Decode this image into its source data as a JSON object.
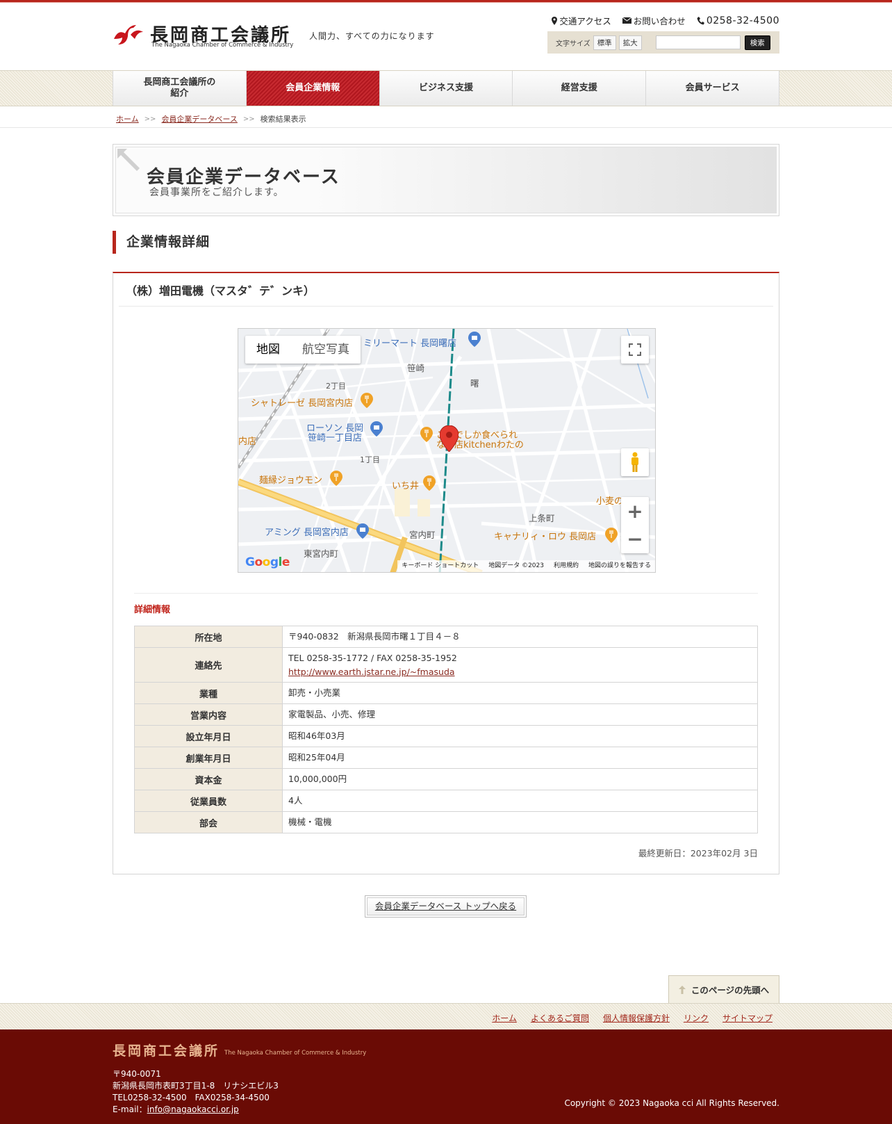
{
  "header": {
    "logo_name": "長岡商工会議所",
    "logo_en": "The Nagaoka Chamber of Commerce & Industry",
    "tagline": "人間力、すべての力になります",
    "links": {
      "access": "交通アクセス",
      "contact": "お問い合わせ",
      "tel": "0258-32-4500"
    },
    "font_size_label": "文字サイズ",
    "font_standard": "標準",
    "font_large": "拡大",
    "search_button": "検索",
    "search_value": ""
  },
  "nav": {
    "items": [
      {
        "label": "長岡商工会議所の\n紹介"
      },
      {
        "label": "会員企業情報",
        "active": true
      },
      {
        "label": "ビジネス支援"
      },
      {
        "label": "経営支援"
      },
      {
        "label": "会員サービス"
      }
    ]
  },
  "breadcrumb": {
    "home": "ホーム",
    "db": "会員企業データベース",
    "current": "検索結果表示"
  },
  "banner": {
    "title": "会員企業データベース",
    "subtitle": "会員事業所をご紹介します。"
  },
  "section_title": "企業情報詳細",
  "company": {
    "name": "（株）増田電機（マスタ゛テ゛ンキ）"
  },
  "map": {
    "type_map": "地図",
    "type_satellite": "航空写真",
    "labels": {
      "familymart": "ミリーマート 長岡曙店",
      "sasazaki": "笹崎",
      "akebono": "曙",
      "chome2": "2丁目",
      "chateraise": "シャトレーゼ 長岡宮内店",
      "lawson1": "ローソン 長岡",
      "lawson2": "笹崎一丁目店",
      "store_left": "内店",
      "kitchen1": "ここでしか食べられ",
      "kitchen2": "ない店kitchenわたの",
      "chome1": "1丁目",
      "jouwon": "麺縁ジョウモン",
      "ichii": "いち井",
      "komugi": "小麦の",
      "kamijo": "上条町",
      "aming": "アミング 長岡宮内店",
      "miyauchi": "宮内町",
      "kyanari": "キャナリィ・ロウ 長岡店",
      "higashi": "東宮内町"
    },
    "google": "Google",
    "attribution": [
      "キーボード ショートカット",
      "地図データ ©2023",
      "利用規約",
      "地図の誤りを報告する"
    ]
  },
  "details": {
    "title": "詳細情報",
    "rows": [
      {
        "label": "所在地",
        "value": "〒940-0832　新潟県長岡市曙１丁目４－８"
      },
      {
        "label": "連絡先",
        "value": "TEL 0258-35-1772 / FAX 0258-35-1952",
        "link": "http://www.earth.jstar.ne.jp/~fmasuda"
      },
      {
        "label": "業種",
        "value": "卸売・小売業"
      },
      {
        "label": "営業内容",
        "value": "家電製品、小売、修理"
      },
      {
        "label": "設立年月日",
        "value": "昭和46年03月"
      },
      {
        "label": "創業年月日",
        "value": "昭和25年04月"
      },
      {
        "label": "資本金",
        "value": "10,000,000円"
      },
      {
        "label": "従業員数",
        "value": "4人"
      },
      {
        "label": "部会",
        "value": "機械・電機"
      }
    ],
    "updated": "最終更新日：2023年02月 3日"
  },
  "back_button": "会員企業データベース トップへ戻る",
  "pagetop": "このページの先頭へ",
  "footer_links": [
    "ホーム",
    "よくあるご質問",
    "個人情報保護方針",
    "リンク",
    "サイトマップ"
  ],
  "footer": {
    "logo": "長岡商工会議所",
    "logo_en": "The Nagaoka Chamber of Commerce & Industry",
    "zip": "〒940-0071",
    "address": "新潟県長岡市表町3丁目1-8　リナシエビル3",
    "tel": "TEL0258-32-4500　FAX0258-34-4500",
    "email_label": "E-mail：",
    "email": "info@nagaokacci.or.jp",
    "copyright": "Copyright © 2023 Nagaoka cci All Rights Reserved."
  },
  "colors": {
    "brand_red": "#b8261c",
    "footer_bg": "#6a0b05",
    "th_bg": "#f2ece0"
  }
}
